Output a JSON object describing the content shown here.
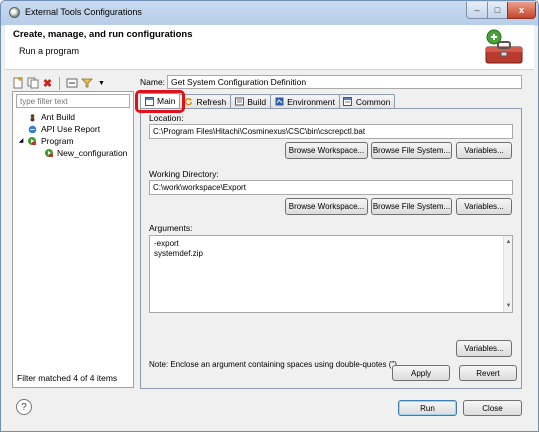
{
  "window": {
    "title": "External Tools Configurations",
    "close_glyph": "x"
  },
  "header": {
    "title": "Create, manage, and run configurations",
    "subtitle": "Run a program"
  },
  "left": {
    "filter_placeholder": "type filter text",
    "tree": [
      {
        "label": "Ant Build",
        "icon": "ant-icon"
      },
      {
        "label": "API Use Report",
        "icon": "report-icon"
      },
      {
        "label": "Program",
        "icon": "program-icon",
        "expanded": true
      },
      {
        "label": "New_configuration",
        "icon": "config-icon"
      }
    ],
    "status": "Filter matched 4 of 4 items"
  },
  "form": {
    "name_label": "Name:",
    "name_value": "Get System Configuration Definition",
    "tabs": [
      {
        "label": "Main",
        "icon": "main-tab-icon"
      },
      {
        "label": "Refresh",
        "icon": "refresh-icon"
      },
      {
        "label": "Build",
        "icon": "build-icon"
      },
      {
        "label": "Environment",
        "icon": "environment-icon"
      },
      {
        "label": "Common",
        "icon": "common-icon"
      }
    ],
    "location_label": "Location:",
    "location_value": "C:\\Program Files\\Hitachi\\Cosminexus\\CSC\\bin\\cscrepctl.bat",
    "working_dir_label": "Working Directory:",
    "working_dir_value": "C:\\work\\workspace\\Export",
    "arguments_label": "Arguments:",
    "arguments_lines": [
      "-export",
      "systemdef.zip"
    ],
    "browse_workspace": "Browse Workspace...",
    "browse_file_system": "Browse File System...",
    "variables": "Variables...",
    "note": "Note: Enclose an argument containing spaces using double-quotes (\")."
  },
  "buttons": {
    "apply": "Apply",
    "revert": "Revert",
    "run": "Run",
    "close": "Close"
  },
  "colors": {
    "highlight": "#e0111a",
    "titlebar": "#c9daf0"
  }
}
